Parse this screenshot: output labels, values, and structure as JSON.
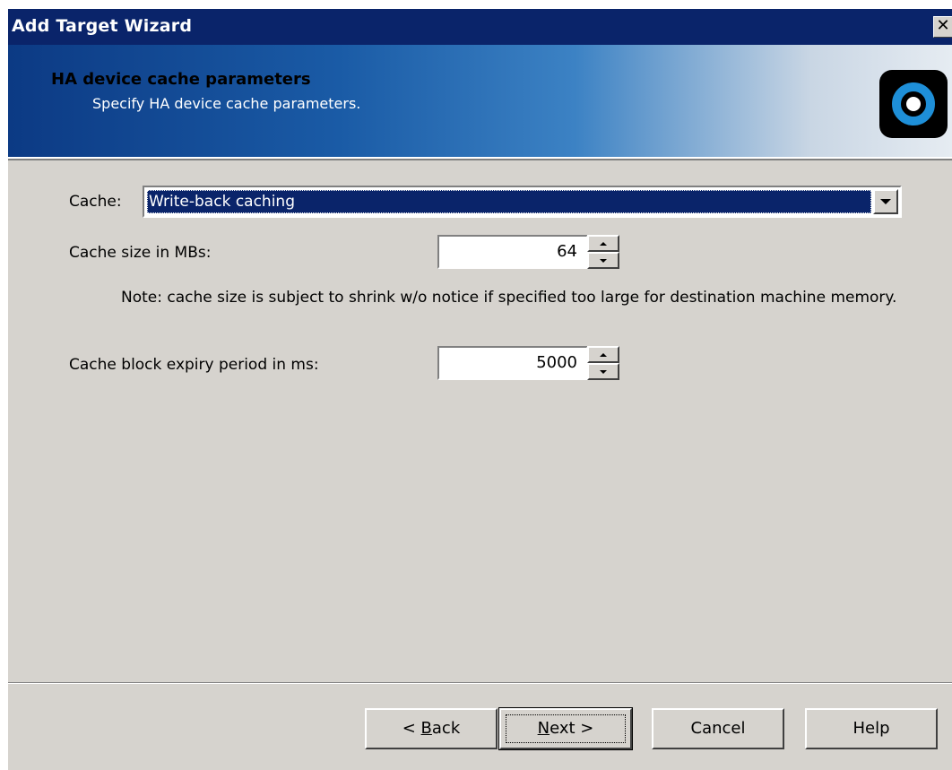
{
  "window": {
    "title": "Add Target Wizard",
    "close_glyph": "✕"
  },
  "header": {
    "title": "HA device cache parameters",
    "subtitle": "Specify HA device cache parameters.",
    "logo_icon": "starwind-logo-icon"
  },
  "form": {
    "cache_label": "Cache:",
    "cache_value": "Write-back caching",
    "cache_size_label": "Cache size in MBs:",
    "cache_size_value": "64",
    "note": "Note: cache size is subject to shrink w/o notice if specified too large for destination machine memory.",
    "expiry_label": "Cache block expiry period in ms:",
    "expiry_value": "5000"
  },
  "buttons": {
    "back_prefix": "< ",
    "back_mnemonic": "B",
    "back_rest": "ack",
    "next_mnemonic": "N",
    "next_rest": "ext >",
    "cancel": "Cancel",
    "help": "Help"
  },
  "colors": {
    "titlebar": "#0a246a",
    "dialog_bg": "#d6d3ce",
    "selection": "#0a246a"
  }
}
